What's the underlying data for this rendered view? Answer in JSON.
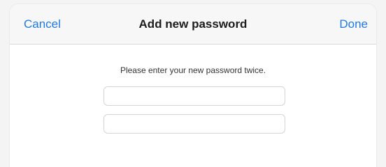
{
  "navbar": {
    "cancel_label": "Cancel",
    "title": "Add new password",
    "done_label": "Done"
  },
  "form": {
    "prompt": "Please enter your new password twice.",
    "password_field": {
      "value": "",
      "placeholder": ""
    },
    "confirm_field": {
      "value": "",
      "placeholder": ""
    }
  },
  "colors": {
    "accent": "#1f7ae8",
    "navbar_bg": "#f7f7f8",
    "border": "#d4d4d8"
  }
}
